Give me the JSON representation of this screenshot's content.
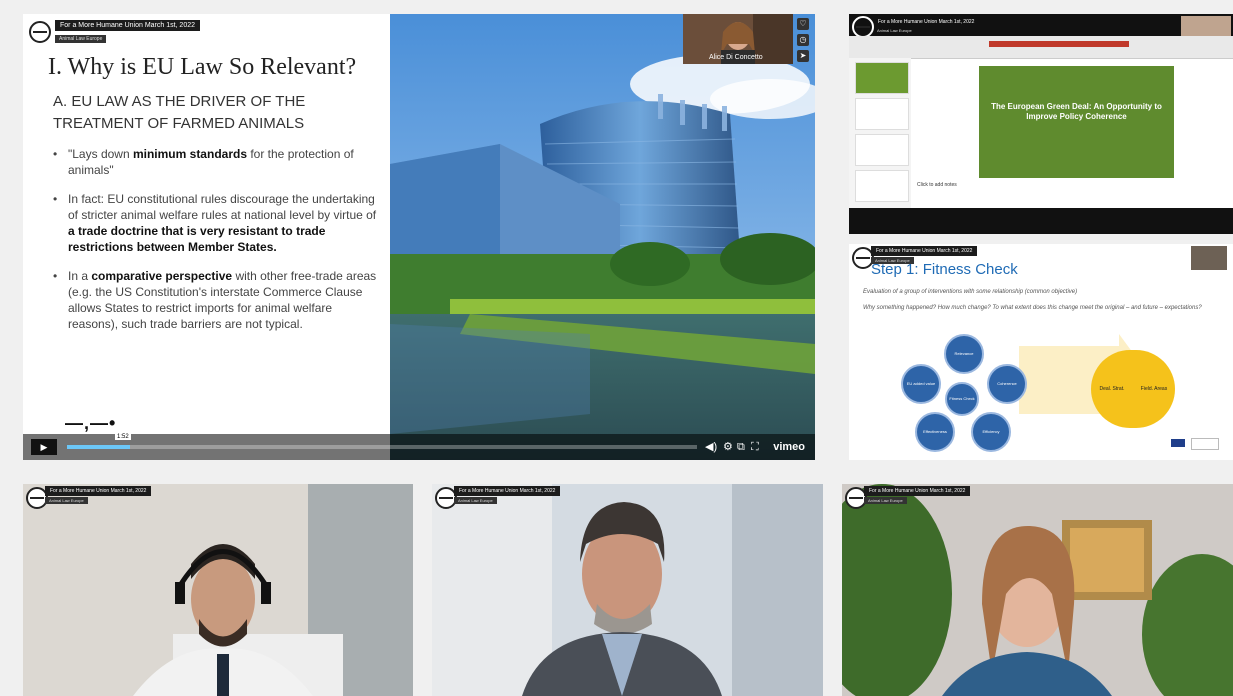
{
  "event": {
    "title": "For a More Humane Union March 1st, 2022",
    "subtitle": "Animal Law Europe"
  },
  "main_video": {
    "slide": {
      "heading": "I. Why is EU Law So Relevant?",
      "subheading": "A. EU LAW AS THE DRIVER OF THE TREATMENT OF FARMED ANIMALS",
      "bullets": [
        {
          "before": "\"Lays down ",
          "bold": "minimum standards",
          "after": " for the protection of animals\""
        },
        {
          "before": "In fact: EU constitutional rules discourage the undertaking of stricter animal welfare rules at national level by virtue of ",
          "bold": "a trade doctrine that is very resistant to trade restrictions between Member States.",
          "after": ""
        },
        {
          "before": "In a ",
          "bold": "comparative perspective",
          "after": " with other free-trade areas (e.g. the US Constitution's interstate Commerce Clause allows States to restrict imports for animal welfare reasons), such trade barriers are not typical."
        }
      ],
      "footer_logo": "—,—•"
    },
    "pip_name": "Alice Di Concetto",
    "player": {
      "play_icon": "▶",
      "progress": 0.1,
      "time": "1:52",
      "brand": "vimeo",
      "control_icons": [
        "volume-icon",
        "settings-icon",
        "pip-icon",
        "fullscreen-icon"
      ]
    }
  },
  "top_right": {
    "slide_title": "The European Green Deal: An Opportunity to Improve Policy Coherence",
    "notes_placeholder": "Click to add notes"
  },
  "middle_right": {
    "heading": "Step 1: Fitness Check",
    "bullet1": "Evaluation of a group of interventions with some relationship (common objective)",
    "bullet2": "Why something happened? How much change? To what extent does this change meet the original – and future – expectations?",
    "nodes": [
      "Relevance",
      "Coherence",
      "Efficiency",
      "Effectiveness",
      "EU added value"
    ],
    "center_node": "Fitness Check",
    "result_left": "Deal. Strat.",
    "result_right": "Field. Areas"
  },
  "colors": {
    "accent_blue": "#1f6bb5",
    "green_slide": "#5f8b2e",
    "progress": "#6cc7f7"
  }
}
